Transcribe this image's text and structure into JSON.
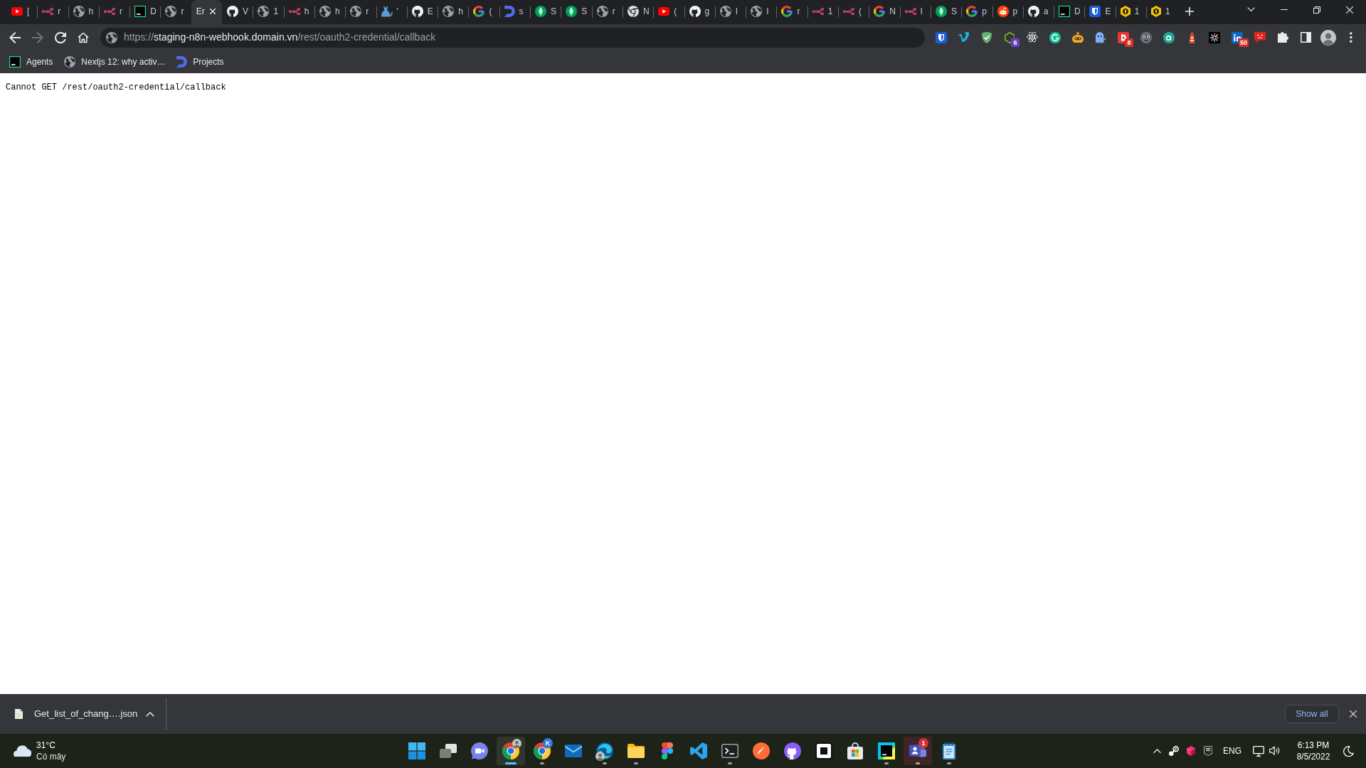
{
  "tabs": [
    {
      "kind": "play",
      "title": "[",
      "selected": false
    },
    {
      "kind": "nodes",
      "title": "r",
      "selected": false
    },
    {
      "kind": "globe",
      "title": "h",
      "selected": false
    },
    {
      "kind": "nodes",
      "title": "r",
      "selected": false
    },
    {
      "kind": "square",
      "title": "D",
      "selected": false
    },
    {
      "kind": "globe",
      "title": "r",
      "selected": false
    },
    {
      "kind": "none",
      "title": "Er",
      "selected": true
    },
    {
      "kind": "octocat",
      "title": "V",
      "selected": false
    },
    {
      "kind": "globe",
      "title": "1",
      "selected": false
    },
    {
      "kind": "nodes",
      "title": "h",
      "selected": false
    },
    {
      "kind": "globe",
      "title": "h",
      "selected": false
    },
    {
      "kind": "globe",
      "title": "r",
      "selected": false
    },
    {
      "kind": "animal",
      "title": "'",
      "selected": false
    },
    {
      "kind": "octocat",
      "title": "E",
      "selected": false
    },
    {
      "kind": "globe",
      "title": "h",
      "selected": false
    },
    {
      "kind": "ring",
      "title": "(",
      "selected": false
    },
    {
      "kind": "swoosh",
      "title": "s",
      "selected": false
    },
    {
      "kind": "leaf",
      "title": "S",
      "selected": false
    },
    {
      "kind": "leaf",
      "title": "S",
      "selected": false
    },
    {
      "kind": "globe",
      "title": "r",
      "selected": false
    },
    {
      "kind": "aperture",
      "title": "N",
      "selected": false
    },
    {
      "kind": "play",
      "title": "(",
      "selected": false
    },
    {
      "kind": "octocat",
      "title": "g",
      "selected": false
    },
    {
      "kind": "globe",
      "title": "I",
      "selected": false
    },
    {
      "kind": "globe",
      "title": "I",
      "selected": false
    },
    {
      "kind": "ring",
      "title": "r",
      "selected": false
    },
    {
      "kind": "nodes",
      "title": "1",
      "selected": false
    },
    {
      "kind": "nodes",
      "title": "(",
      "selected": false
    },
    {
      "kind": "ring",
      "title": "N",
      "selected": false
    },
    {
      "kind": "nodes",
      "title": "I",
      "selected": false
    },
    {
      "kind": "leaf",
      "title": "S",
      "selected": false
    },
    {
      "kind": "ring",
      "title": "p",
      "selected": false
    },
    {
      "kind": "face",
      "title": "p",
      "selected": false
    },
    {
      "kind": "octocat",
      "title": "a",
      "selected": false
    },
    {
      "kind": "square",
      "title": "D",
      "selected": false
    },
    {
      "kind": "shield",
      "title": "E",
      "selected": false
    },
    {
      "kind": "hexagon",
      "title": "1",
      "selected": false
    },
    {
      "kind": "hexagon",
      "title": "1",
      "selected": false
    }
  ],
  "toolbar": {
    "nav_buttons": [
      {
        "kind": "back",
        "disabled": false
      },
      {
        "kind": "forward",
        "disabled": true
      },
      {
        "kind": "reload",
        "disabled": false
      },
      {
        "kind": "home",
        "disabled": false
      }
    ],
    "address": {
      "scheme": "https://",
      "host": "staging-n8n-webhook.domain.vn",
      "path": "/rest/oauth2-credential/callback"
    },
    "extensions": [
      {
        "kind": "shield"
      },
      {
        "kind": "vmark"
      },
      {
        "kind": "checkshield"
      },
      {
        "kind": "hexoutline",
        "badge": {
          "text": "6",
          "color": "#6a3fc4"
        }
      },
      {
        "kind": "atom"
      },
      {
        "kind": "gring"
      },
      {
        "kind": "robot"
      },
      {
        "kind": "ghost"
      },
      {
        "kind": "tile",
        "badge": {
          "text": "8",
          "color": "#d93025"
        }
      },
      {
        "kind": "goggles"
      },
      {
        "kind": "disc"
      },
      {
        "kind": "lighthouse"
      },
      {
        "kind": "starburst"
      },
      {
        "kind": "card",
        "badge": {
          "text": "50",
          "color": "#d93025"
        }
      },
      {
        "kind": "chat"
      }
    ]
  },
  "bookmarks": [
    {
      "kind": "square",
      "label": "Agents"
    },
    {
      "kind": "globe",
      "label": "Nextjs 12: why activ…"
    },
    {
      "kind": "swoosh",
      "label": "Projects"
    }
  ],
  "page": {
    "message": "Cannot GET /rest/oauth2-credential/callback"
  },
  "download_bar": {
    "items": [
      {
        "filename": "Get_list_of_chang….json"
      }
    ],
    "show_all": "Show all"
  },
  "taskbar": {
    "weather": {
      "temperature": "31°C",
      "condition": "Có mây"
    },
    "apps": [
      {
        "kind": "start",
        "running": false,
        "selected": false,
        "flashing": false,
        "avatar": false
      },
      {
        "kind": "taskview",
        "running": false,
        "selected": false,
        "flashing": false,
        "avatar": false
      },
      {
        "kind": "videochat",
        "running": false,
        "selected": false,
        "flashing": false,
        "avatar": false
      },
      {
        "kind": "chrome",
        "running": true,
        "selected": true,
        "flashing": false,
        "avatar": true
      },
      {
        "kind": "chrome",
        "running": true,
        "selected": false,
        "flashing": false,
        "avatar": false,
        "badge": {
          "text": "K",
          "color": "#2f7be5"
        }
      },
      {
        "kind": "mail",
        "running": false,
        "selected": false,
        "flashing": false,
        "avatar": false
      },
      {
        "kind": "edge",
        "running": true,
        "selected": false,
        "flashing": false,
        "avatar": true
      },
      {
        "kind": "folder",
        "running": true,
        "selected": false,
        "flashing": false,
        "avatar": false
      },
      {
        "kind": "figma",
        "running": false,
        "selected": false,
        "flashing": false,
        "avatar": false
      },
      {
        "kind": "vscode",
        "running": false,
        "selected": false,
        "flashing": false,
        "avatar": false
      },
      {
        "kind": "terminal",
        "running": true,
        "selected": false,
        "flashing": false,
        "avatar": false
      },
      {
        "kind": "compass",
        "running": false,
        "selected": false,
        "flashing": false,
        "avatar": false
      },
      {
        "kind": "desktop",
        "running": false,
        "selected": false,
        "flashing": false,
        "avatar": false
      },
      {
        "kind": "notion",
        "running": false,
        "selected": false,
        "flashing": false,
        "avatar": false
      },
      {
        "kind": "store",
        "running": false,
        "selected": false,
        "flashing": false,
        "avatar": false
      },
      {
        "kind": "ws",
        "running": true,
        "selected": false,
        "flashing": false,
        "avatar": false
      },
      {
        "kind": "teams",
        "running": true,
        "selected": false,
        "flashing": true,
        "avatar": false,
        "badge": {
          "text": "1",
          "color": "#d13438"
        }
      },
      {
        "kind": "notepad",
        "running": true,
        "selected": false,
        "flashing": false,
        "avatar": false
      }
    ],
    "tray": {
      "language": "ENG",
      "time": "6:13 PM",
      "date": "8/5/2022"
    }
  }
}
